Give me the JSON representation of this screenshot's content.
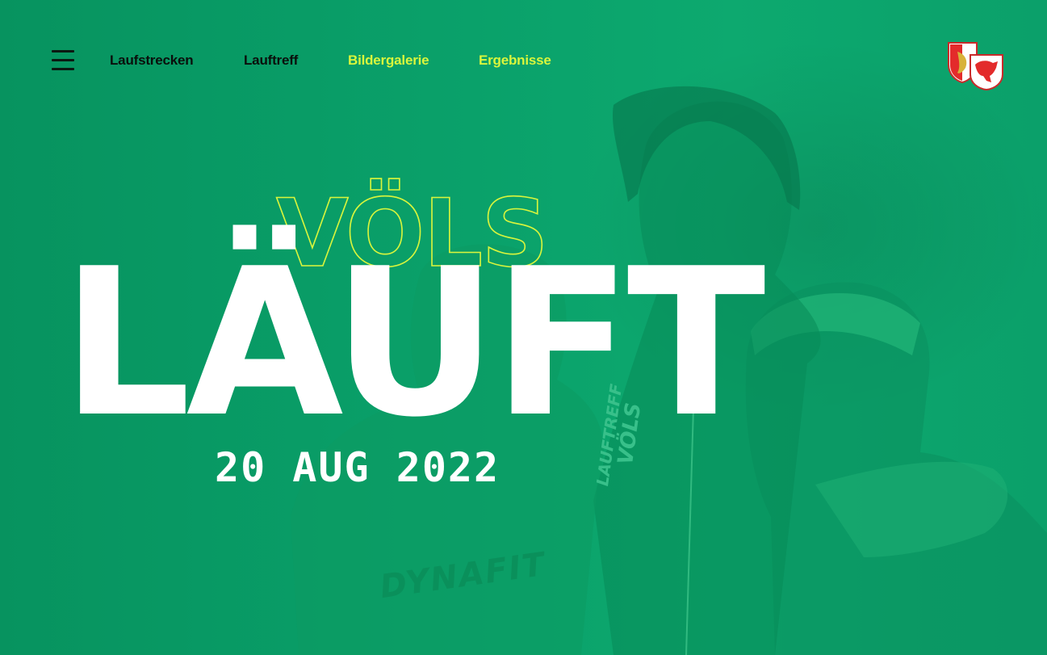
{
  "nav": {
    "menu_icon": "hamburger-menu-icon",
    "links": [
      {
        "label": "Laufstrecken"
      },
      {
        "label": "Lauftreff"
      },
      {
        "label": "Bildergalerie"
      },
      {
        "label": "Ergebnisse"
      }
    ],
    "crest_icon": "municipal-crest-logo"
  },
  "hero": {
    "title_outline": "VÖLS",
    "title_main": "LÄUFT",
    "date": "20 AUG 2022",
    "photo_shirt_text": "DYNAFIT",
    "photo_jacket_text_line1": "LAUFTREFF",
    "photo_jacket_text_line2": "VÖLS"
  },
  "colors": {
    "background_green": "#0ea06a",
    "nav_dark": "#0a0f0c",
    "accent_lime": "#d9f53c",
    "title_white": "#ffffff",
    "crest_red": "#e32b2b",
    "crest_gold": "#d8b23a"
  }
}
